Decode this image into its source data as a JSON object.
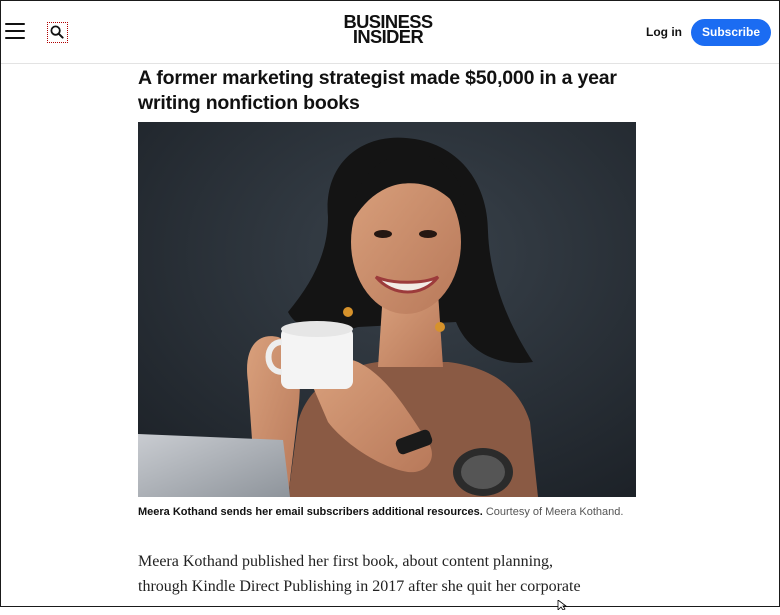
{
  "header": {
    "logo_line1": "BUSINESS",
    "logo_line2": "INSIDER",
    "login_label": "Log in",
    "subscribe_label": "Subscribe",
    "subscribe_color": "#1b6cf2"
  },
  "icons": {
    "menu": "hamburger-menu-icon",
    "search": "search-icon"
  },
  "article": {
    "headline_line1": "A former marketing strategist made $50,000 in a year",
    "headline_line2": "writing nonfiction books",
    "caption_text": "Meera Kothand sends her email subscribers additional resources.",
    "caption_credit": "Courtesy of Meera Kothand.",
    "body_line1": "Meera Kothand published her first book, about content planning,",
    "body_line2": "through Kindle Direct Publishing in 2017 after she quit her corporate"
  }
}
